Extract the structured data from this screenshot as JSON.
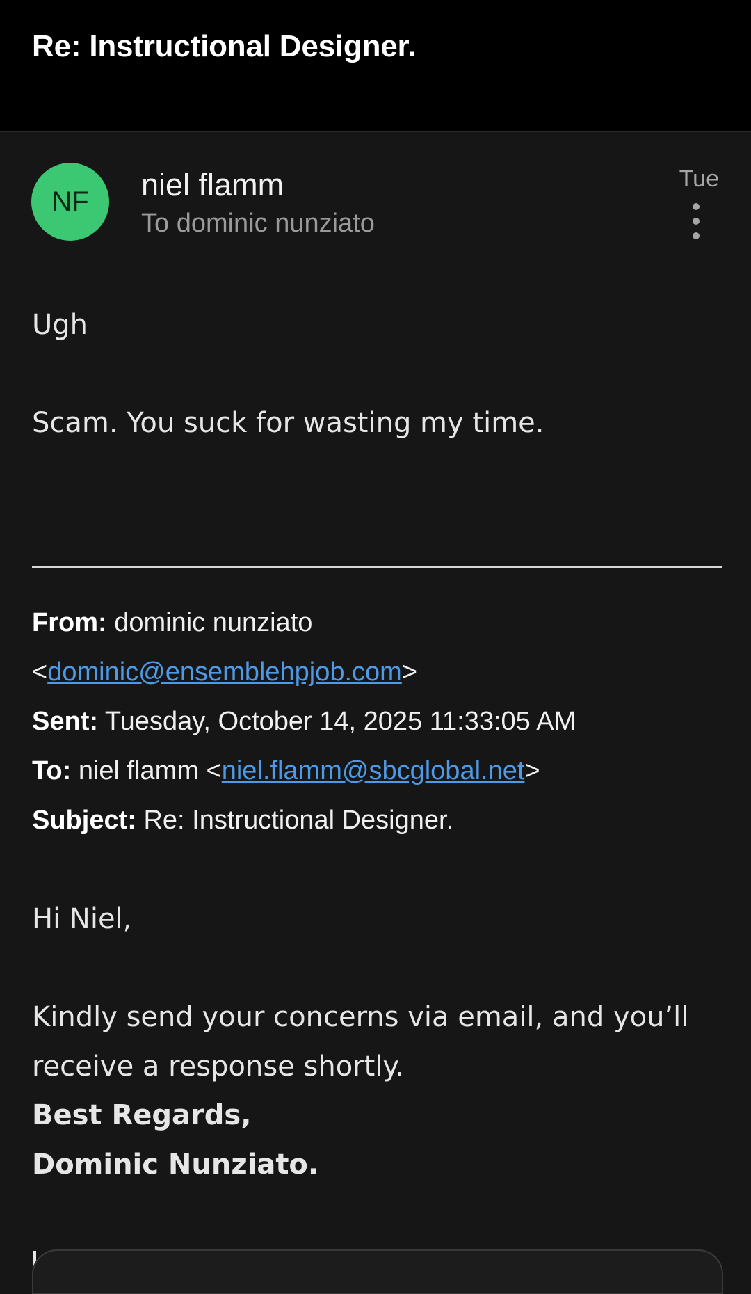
{
  "header": {
    "subject": "Re: Instructional Designer."
  },
  "message": {
    "avatar_initials": "NF",
    "sender_name": "niel flamm",
    "recipient_line": "To dominic nunziato",
    "date": "Tue",
    "avatar_color": "#3cc873",
    "lines": [
      "Ugh",
      "Scam.  You suck for wasting my time."
    ]
  },
  "quoted": {
    "from_label": "From:",
    "from_name": "dominic nunziato",
    "from_email": "dominic@ensemblehpjob.com",
    "sent_label": "Sent:",
    "sent_value": "Tuesday, October 14, 2025 11:33:05 AM",
    "to_label": "To:",
    "to_name": "niel flamm",
    "to_email": "niel.flamm@sbcglobal.net",
    "subject_label": "Subject:",
    "subject_value": "Re: Instructional Designer.",
    "greeting": "Hi Niel,",
    "body_line1": "Kindly send your concerns via email, and you’ll",
    "body_line2": "receive a response shortly.",
    "sign_off": "Best Regards,",
    "signature": "Dominic Nunziato."
  },
  "icons": {
    "more": "more-vertical-icon"
  },
  "colors": {
    "link": "#4f9ae6",
    "background": "#161616",
    "header_bg": "#000000"
  }
}
